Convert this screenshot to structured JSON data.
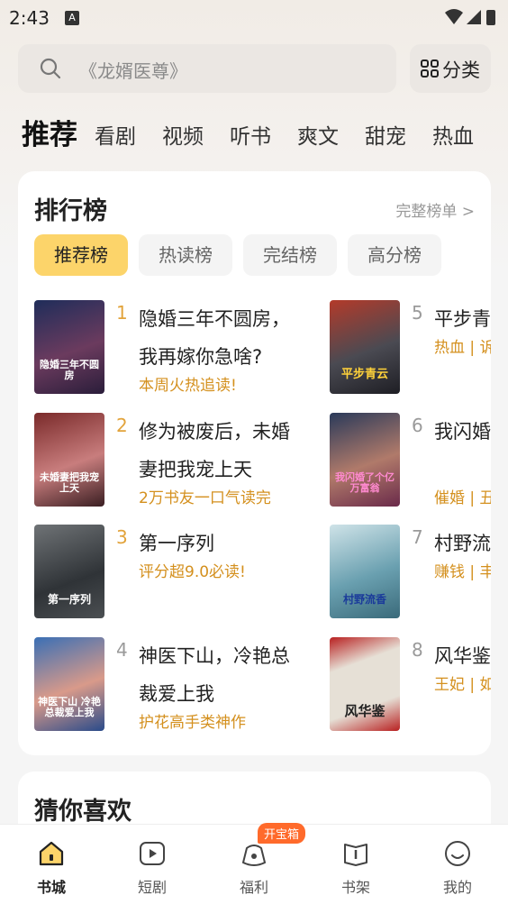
{
  "status": {
    "time": "2:43",
    "notif": "A"
  },
  "search": {
    "placeholder": "《龙婿医尊》",
    "category_label": "分类"
  },
  "tabs": [
    "推荐",
    "看剧",
    "视频",
    "听书",
    "爽文",
    "甜宠",
    "热血"
  ],
  "ranking": {
    "title": "排行榜",
    "more_label": "完整榜单 >",
    "pills": [
      "推荐榜",
      "热读榜",
      "完结榜",
      "高分榜"
    ],
    "books": [
      {
        "rank": "1",
        "title": "隐婚三年不圆房，我再嫁你急啥?",
        "tag": "本周火热追读!",
        "cover_text": "隐婚三年不圆房"
      },
      {
        "rank": "2",
        "title": "修为被废后，未婚妻把我宠上天",
        "tag": "2万书友一口气读完",
        "cover_text": "未婚妻把我宠上天"
      },
      {
        "rank": "3",
        "title": "第一序列",
        "tag": "评分超9.0必读!",
        "cover_text": "第一序列"
      },
      {
        "rank": "4",
        "title": "神医下山，冷艳总裁爱上我",
        "tag": "护花高手类神作",
        "cover_text": "神医下山 冷艳总裁爱上我"
      },
      {
        "rank": "5",
        "title": "平步青",
        "tag": "热血 | 诉",
        "cover_text": "平步青云"
      },
      {
        "rank": "6",
        "title": "我闪婚翁",
        "tag": "催婚 | 丑",
        "cover_text": "我闪婚了个亿万富翁"
      },
      {
        "rank": "7",
        "title": "村野流",
        "tag": "赚钱 | 丰",
        "cover_text": "村野流香"
      },
      {
        "rank": "8",
        "title": "风华鉴",
        "tag": "王妃 | 如",
        "cover_text": "风华鉴"
      }
    ]
  },
  "guess": {
    "title": "猜你喜欢"
  },
  "nav": {
    "badge": "开宝箱",
    "items": [
      "书城",
      "短剧",
      "福利",
      "书架",
      "我的"
    ]
  },
  "colors": {
    "accent": "#fcd46a",
    "tag": "#d4901e",
    "badge": "#ff6a2b"
  }
}
